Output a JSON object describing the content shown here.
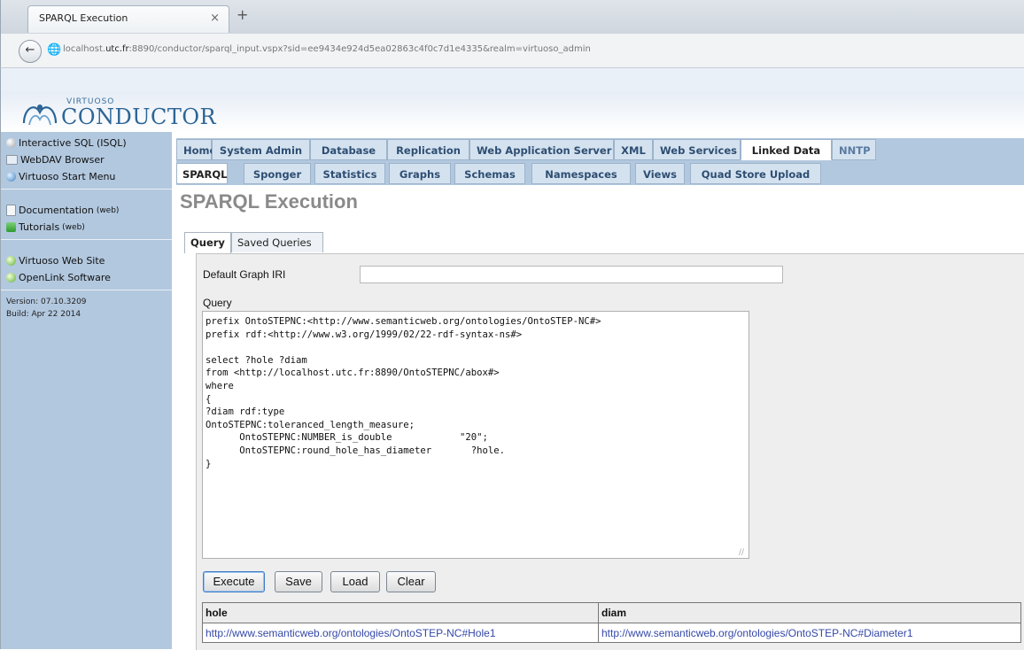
{
  "browser": {
    "tab_title": "SPARQL Execution",
    "tab_close": "×",
    "new_tab": "+",
    "url_prefix": "localhost.",
    "url_host": "utc.fr",
    "url_rest": ":8890/conductor/sparql_input.vspx?sid=ee9434e924d5ea02863c4f0c7d1e4335&realm=virtuoso_admin"
  },
  "logo": {
    "sub": "VIRTUOSO",
    "main": "CONDUCTOR"
  },
  "sidebar": {
    "group1": [
      {
        "label": "Interactive SQL (ISQL)",
        "icon": "gear-icon"
      },
      {
        "label": "WebDAV Browser",
        "icon": "folder-icon"
      },
      {
        "label": "Virtuoso Start Menu",
        "icon": "start-icon"
      }
    ],
    "group2": [
      {
        "label": "Documentation",
        "suffix": "(web)",
        "icon": "document-icon"
      },
      {
        "label": "Tutorials",
        "suffix": "(web)",
        "icon": "tutorial-icon"
      }
    ],
    "group3": [
      {
        "label": "Virtuoso Web Site",
        "icon": "globe-icon"
      },
      {
        "label": "OpenLink Software",
        "icon": "globe-icon"
      }
    ],
    "version": "Version: 07.10.3209",
    "build": "Build: Apr 22 2014"
  },
  "main_tabs": [
    {
      "label": "Home"
    },
    {
      "label": "System Admin"
    },
    {
      "label": "Database"
    },
    {
      "label": "Replication"
    },
    {
      "label": "Web Application Server"
    },
    {
      "label": "XML"
    },
    {
      "label": "Web Services"
    },
    {
      "label": "Linked Data",
      "active": true
    },
    {
      "label": "NNTP"
    }
  ],
  "sub_tabs": [
    {
      "label": "SPARQL",
      "active": true
    },
    {
      "label": "Sponger"
    },
    {
      "label": "Statistics"
    },
    {
      "label": "Graphs"
    },
    {
      "label": "Schemas"
    },
    {
      "label": "Namespaces"
    },
    {
      "label": "Views"
    },
    {
      "label": "Quad Store Upload"
    }
  ],
  "page_title": "SPARQL Execution",
  "query_tabs": [
    {
      "label": "Query",
      "active": true
    },
    {
      "label": "Saved Queries"
    }
  ],
  "form": {
    "default_graph_label": "Default Graph IRI",
    "default_graph_value": "",
    "query_label": "Query",
    "query_text": "prefix OntoSTEPNC:<http://www.semanticweb.org/ontologies/OntoSTEP-NC#>\nprefix rdf:<http://www.w3.org/1999/02/22-rdf-syntax-ns#>\n\nselect ?hole ?diam\nfrom <http://localhost.utc.fr:8890/OntoSTEPNC/abox#>\nwhere\n{\n?diam rdf:type\nOntoSTEPNC:toleranced_length_measure;\n      OntoSTEPNC:NUMBER_is_double            \"20\";\n      OntoSTEPNC:round_hole_has_diameter       ?hole.\n}"
  },
  "buttons": {
    "execute": "Execute",
    "save": "Save",
    "load": "Load",
    "clear": "Clear"
  },
  "results": {
    "headers": [
      "hole",
      "diam"
    ],
    "rows": [
      [
        "http://www.semanticweb.org/ontologies/OntoSTEP-NC#Hole1",
        "http://www.semanticweb.org/ontologies/OntoSTEP-NC#Diameter1"
      ]
    ]
  }
}
